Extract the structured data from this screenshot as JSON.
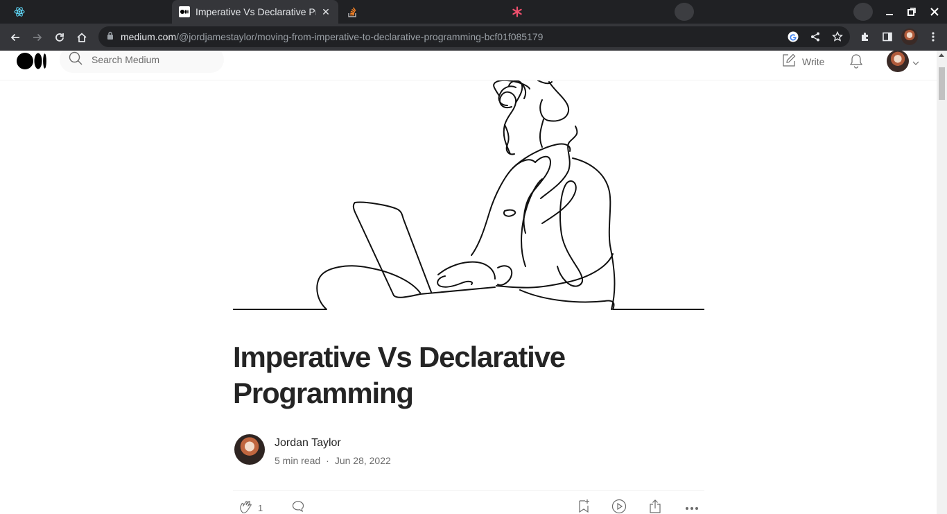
{
  "browser": {
    "tabs": [
      {
        "title": "",
        "icon": "react-icon",
        "active": false
      },
      {
        "title": "Imperative Vs Declarative Programming",
        "icon": "medium-icon",
        "active": true
      },
      {
        "title": "",
        "icon": "stackoverflow-icon",
        "active": false
      },
      {
        "title": "",
        "icon": "asterisk-icon",
        "active": false
      }
    ],
    "url_host": "medium.com",
    "url_path": "/@jordjamestaylor/moving-from-imperative-to-declarative-programming-bcf01f085179"
  },
  "header": {
    "search_placeholder": "Search Medium",
    "write_label": "Write"
  },
  "article": {
    "title": "Imperative Vs Declarative Programming",
    "author": "Jordan Taylor",
    "read_time": "5 min read",
    "separator": "·",
    "date": "Jun 28, 2022",
    "clap_count": "1"
  }
}
